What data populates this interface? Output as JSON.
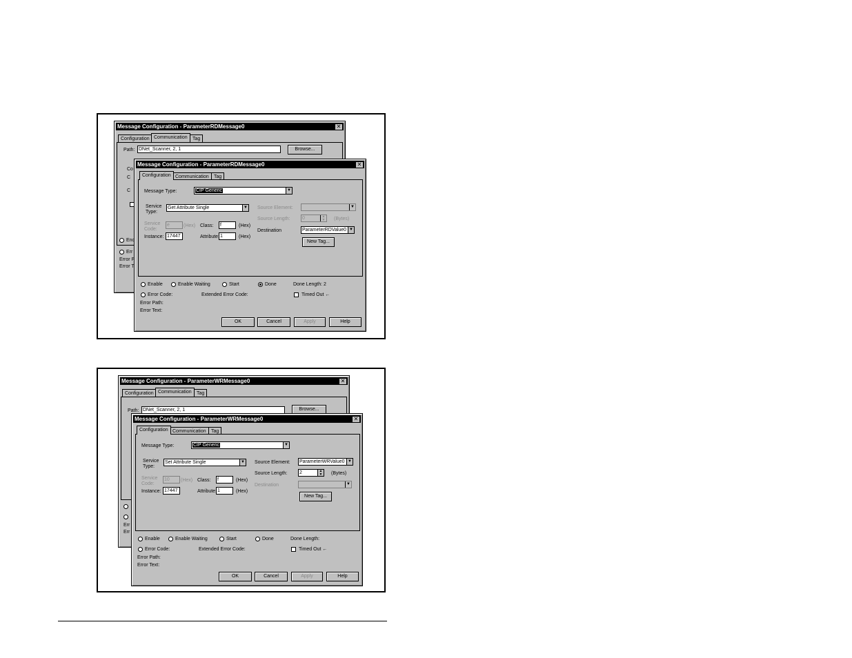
{
  "dialogs": [
    {
      "back": {
        "title": "Message Configuration - ParameterRDMessage0",
        "tabs": [
          "Configuration",
          "Communication",
          "Tag"
        ],
        "path_label": "Path:",
        "path_value": "DNet_Scanner, 2, 1",
        "browse": "Browse...",
        "partial": [
          "Co",
          "C",
          "C",
          "Enc",
          "Err",
          "Error P",
          "Error T"
        ]
      },
      "front": {
        "title": "Message Configuration - ParameterRDMessage0",
        "tabs": [
          "Configuration",
          "Communication",
          "Tag"
        ],
        "message_type_label": "Message Type:",
        "message_type_value": "CIP Generic",
        "service_type_label_1": "Service",
        "service_type_label_2": "Type:",
        "service_type_value": "Get Attribute Single",
        "service_code_label_1": "Service",
        "service_code_label_2": "Code:",
        "service_code_value": "e",
        "hex1": "(Hex)",
        "class_label": "Class:",
        "class_value": "f",
        "hex2": "(Hex)",
        "instance_label": "Instance:",
        "instance_value": "17447",
        "attribute_label": "Attribute:",
        "attribute_value": "1",
        "hex3": "(Hex)",
        "source_element_label": "Source Element:",
        "source_element_value": "",
        "source_length_label": "Source Length:",
        "source_length_value": "0",
        "bytes": "(Bytes)",
        "destination_label": "Destination",
        "destination_value": "ParameterRDValue0",
        "new_tag": "New Tag...",
        "status": {
          "enable": "Enable",
          "enable_waiting": "Enable Waiting",
          "start": "Start",
          "done": "Done",
          "done_length": "Done Length:  2",
          "selected": "done",
          "error_code": "Error Code:",
          "extended_error_code": "Extended Error Code:",
          "timed_out": "Timed Out ←",
          "error_path": "Error Path:",
          "error_text": "Error Text:"
        },
        "buttons": {
          "ok": "OK",
          "cancel": "Cancel",
          "apply": "Apply",
          "help": "Help"
        }
      }
    },
    {
      "back": {
        "title": "Message Configuration - ParameterWRMessage0",
        "tabs": [
          "Configuration",
          "Communication",
          "Tag"
        ],
        "path_label": "Path:",
        "path_value": "DNet_Scanner, 2, 1",
        "browse": "Browse...",
        "partial": [
          "",
          "",
          "",
          "",
          "",
          "Err",
          "Err"
        ]
      },
      "front": {
        "title": "Message Configuration - ParameterWRMessage0",
        "tabs": [
          "Configuration",
          "Communication",
          "Tag"
        ],
        "message_type_label": "Message Type:",
        "message_type_value": "CIP Generic",
        "service_type_label_1": "Service",
        "service_type_label_2": "Type:",
        "service_type_value": "Set Attribute Single",
        "service_code_label_1": "Service",
        "service_code_label_2": "Code:",
        "service_code_value": "10",
        "hex1": "(Hex)",
        "class_label": "Class:",
        "class_value": "f",
        "hex2": "(Hex)",
        "instance_label": "Instance:",
        "instance_value": "17447",
        "attribute_label": "Attribute:",
        "attribute_value": "1",
        "hex3": "(Hex)",
        "source_element_label": "Source Element:",
        "source_element_value": "ParameterWRValue0",
        "source_length_label": "Source Length:",
        "source_length_value": "2",
        "bytes": "(Bytes)",
        "destination_label": "Destination",
        "destination_value": "",
        "new_tag": "New Tag...",
        "status": {
          "enable": "Enable",
          "enable_waiting": "Enable Waiting",
          "start": "Start",
          "done": "Done",
          "done_length": "Done Length:",
          "selected": "none",
          "error_code": "Error Code:",
          "extended_error_code": "Extended Error Code:",
          "timed_out": "Timed Out ←",
          "error_path": "Error Path:",
          "error_text": "Error Text:"
        },
        "buttons": {
          "ok": "OK",
          "cancel": "Cancel",
          "apply": "Apply",
          "help": "Help"
        }
      }
    }
  ]
}
